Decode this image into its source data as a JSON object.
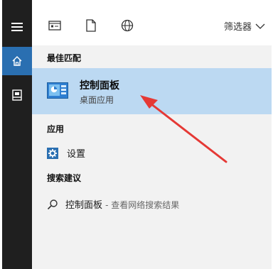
{
  "sidebar": {
    "items": [
      {
        "icon": "hamburger-menu-icon"
      },
      {
        "icon": "home-icon",
        "active": true
      },
      {
        "icon": "documents-icon"
      }
    ]
  },
  "toolbar": {
    "icons": [
      "apps-icon",
      "document-icon",
      "web-globe-icon"
    ],
    "filter_label": "筛选器"
  },
  "best_match": {
    "heading": "最佳匹配",
    "title": "控制面板",
    "subtitle": "桌面应用",
    "icon": "control-panel-icon"
  },
  "apps": {
    "heading": "应用",
    "items": [
      {
        "label": "设置",
        "icon": "settings-gear-icon"
      }
    ]
  },
  "search_suggestions": {
    "heading": "搜索建议",
    "items": [
      {
        "query": "控制面板",
        "suffix": "- 查看网络搜索结果",
        "icon": "search-icon"
      }
    ]
  },
  "colors": {
    "sidebar": "#1f1f1f",
    "active": "#2a6fb1",
    "highlight": "#bcd9f2",
    "annotation_arrow": "#e53935"
  }
}
